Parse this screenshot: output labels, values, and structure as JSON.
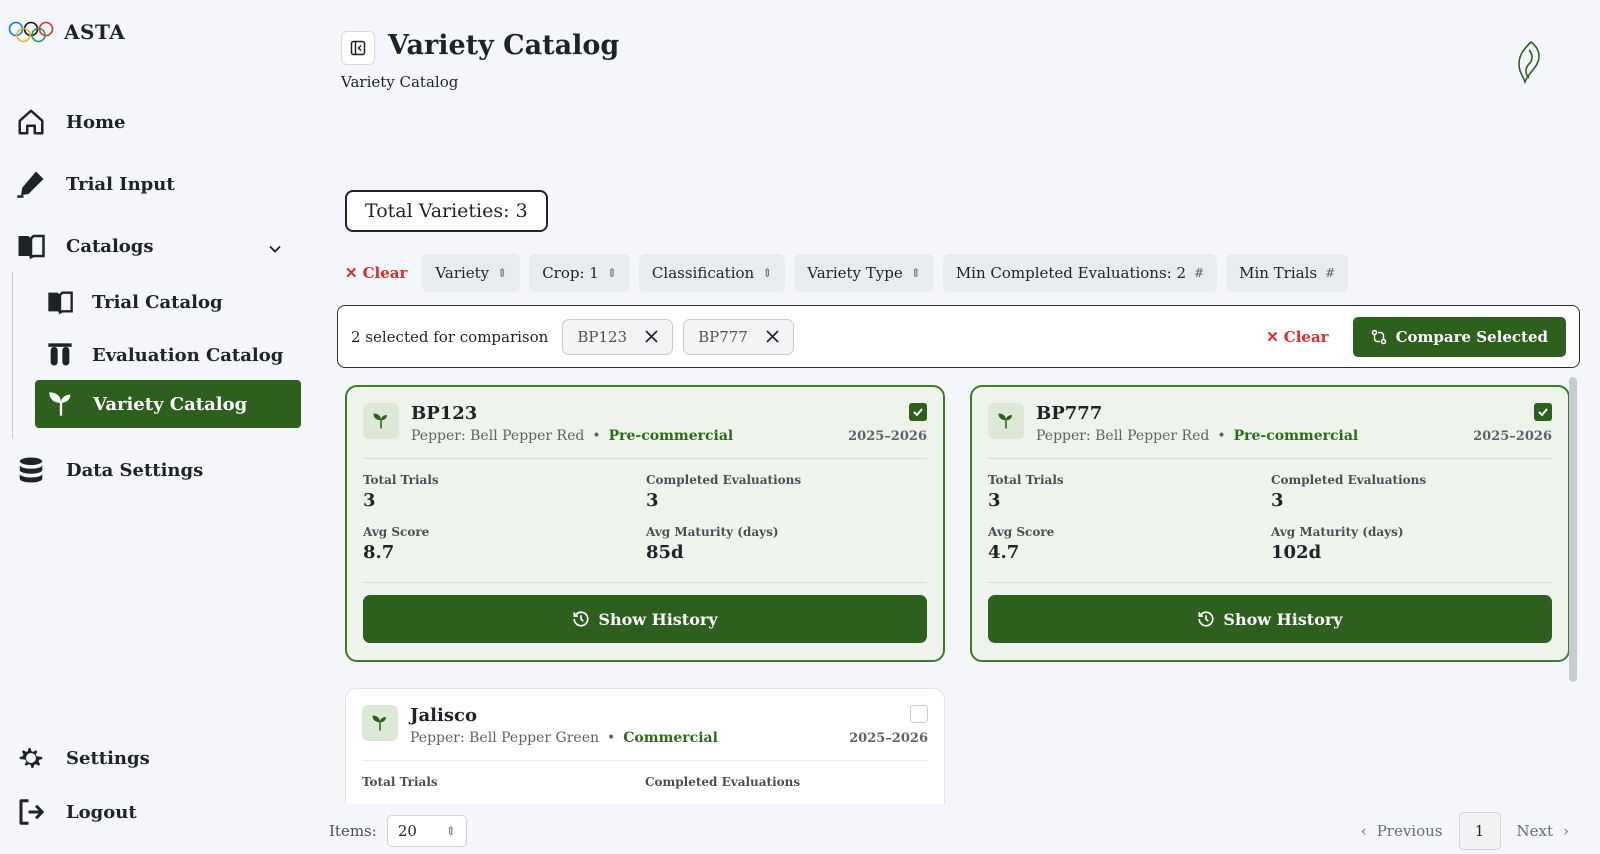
{
  "app": {
    "name": "ASTA"
  },
  "sidebar": {
    "home": "Home",
    "trial_input": "Trial Input",
    "catalogs": "Catalogs",
    "sub": {
      "trial_catalog": "Trial Catalog",
      "evaluation_catalog": "Evaluation Catalog",
      "variety_catalog": "Variety Catalog"
    },
    "data_settings": "Data Settings",
    "settings": "Settings",
    "logout": "Logout"
  },
  "header": {
    "title": "Variety Catalog",
    "breadcrumb": "Variety Catalog"
  },
  "summary": {
    "total": "Total Varieties: 3"
  },
  "filters": {
    "clear": "Clear",
    "chips": [
      "Variety",
      "Crop: 1",
      "Classification",
      "Variety Type",
      "Min Completed Evaluations: 2",
      "Min Trials"
    ]
  },
  "compare": {
    "text": "2 selected for comparison",
    "selected": [
      "BP123",
      "BP777"
    ],
    "clear": "Clear",
    "button": "Compare Selected"
  },
  "cards": [
    {
      "name": "BP123",
      "crop": "Pepper: Bell Pepper Red",
      "classification": "Pre-commercial",
      "years": "2025–2026",
      "total_trials_label": "Total Trials",
      "total_trials": "3",
      "completed_label": "Completed Evaluations",
      "completed": "3",
      "avg_score_label": "Avg Score",
      "avg_score": "8.7",
      "avg_maturity_label": "Avg Maturity (days)",
      "avg_maturity": "85d",
      "history": "Show History",
      "selected": true
    },
    {
      "name": "BP777",
      "crop": "Pepper: Bell Pepper Red",
      "classification": "Pre-commercial",
      "years": "2025–2026",
      "total_trials_label": "Total Trials",
      "total_trials": "3",
      "completed_label": "Completed Evaluations",
      "completed": "3",
      "avg_score_label": "Avg Score",
      "avg_score": "4.7",
      "avg_maturity_label": "Avg Maturity (days)",
      "avg_maturity": "102d",
      "history": "Show History",
      "selected": true
    },
    {
      "name": "Jalisco",
      "crop": "Pepper: Bell Pepper Green",
      "classification": "Commercial",
      "years": "2025–2026",
      "total_trials_label": "Total Trials",
      "completed_label": "Completed Evaluations",
      "selected": false
    }
  ],
  "pagination": {
    "items_label": "Items:",
    "items_value": "20",
    "previous": "Previous",
    "page": "1",
    "next": "Next"
  }
}
